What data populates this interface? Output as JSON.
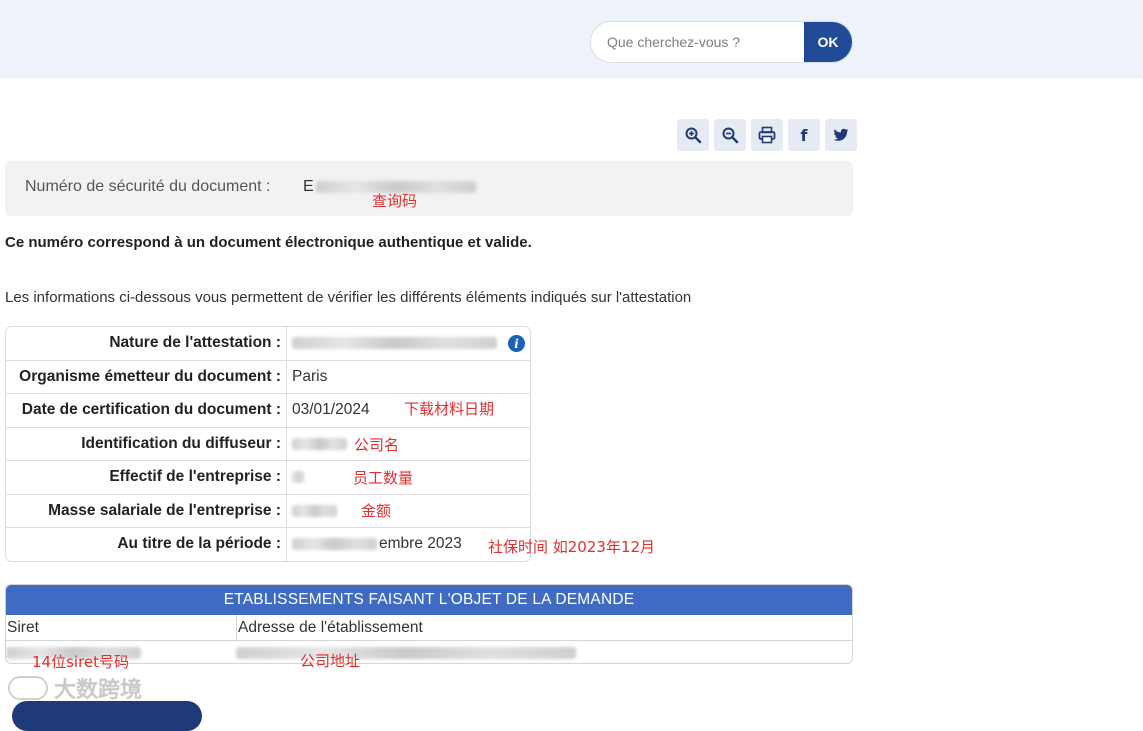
{
  "search": {
    "placeholder": "Que cherchez-vous ?",
    "button_label": "OK"
  },
  "toolbar": {
    "icons": [
      "zoom-in-icon",
      "zoom-out-icon",
      "print-icon",
      "facebook-icon",
      "twitter-icon"
    ],
    "facebook_glyph": "f"
  },
  "security": {
    "label": "Numéro de sécurité du document :",
    "value_prefix": "E",
    "annotation": "查询码"
  },
  "messages": {
    "authentic": "Ce numéro correspond à un document électronique authentique et valide.",
    "info": "Les informations ci-dessous vous permettent de vérifier les différents éléments indiqués sur l'attestation"
  },
  "details": {
    "rows": [
      {
        "label": "Nature de l'attestation :",
        "value": "",
        "annotation": ""
      },
      {
        "label": "Organisme émetteur du document :",
        "value": "Paris",
        "annotation": ""
      },
      {
        "label": "Date de certification du document :",
        "value": "03/01/2024",
        "annotation": "下载材料日期"
      },
      {
        "label": "Identification du diffuseur :",
        "value": "",
        "annotation": "公司名"
      },
      {
        "label": "Effectif de l'entreprise :",
        "value": "",
        "annotation": "员工数量"
      },
      {
        "label": "Masse salariale de l'entreprise :",
        "value": "",
        "annotation": "金额"
      },
      {
        "label": "Au titre de la période :",
        "value": "embre 2023",
        "annotation": "社保时间 如2023年12月"
      }
    ]
  },
  "establishments": {
    "header": "ETABLISSEMENTS FAISANT L'OBJET DE LA DEMANDE",
    "col_siret": "Siret",
    "col_address": "Adresse de l'établissement",
    "siret_annotation": "14位siret号码",
    "address_annotation": "公司地址"
  },
  "watermark": {
    "text": "大数跨境"
  },
  "colors": {
    "brand_blue": "#1f4b99",
    "table_header_blue": "#3f6cc2",
    "annotation_red": "#e03030"
  }
}
